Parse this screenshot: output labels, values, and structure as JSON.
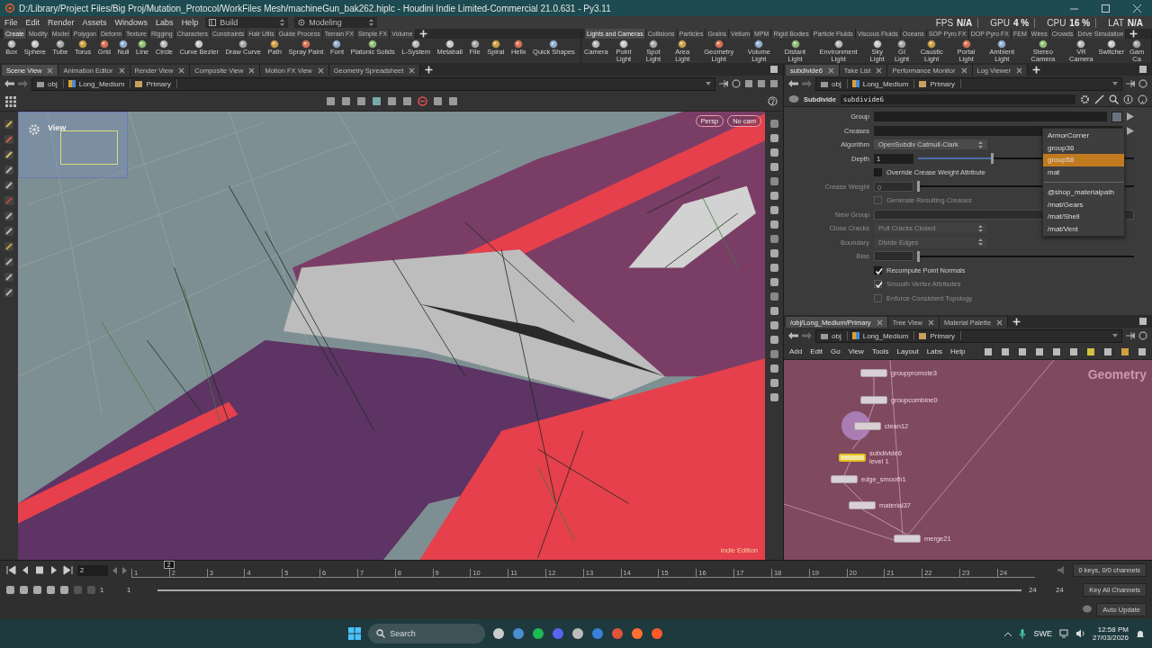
{
  "window": {
    "title": "D:/Library/Project Files/Big Proj/Mutation_Protocol/WorkFiles Mesh/machineGun_bak262.hiplc - Houdini Indie Limited-Commercial 21.0.631 - Py3.11"
  },
  "menu": [
    "File",
    "Edit",
    "Render",
    "Assets",
    "Windows",
    "Labs",
    "Help"
  ],
  "desktops": [
    {
      "label": "Build"
    },
    {
      "label": "Modeling"
    }
  ],
  "performance": [
    {
      "label": "FPS",
      "value": "N/A"
    },
    {
      "label": "GPU",
      "value": "4 %"
    },
    {
      "label": "CPU",
      "value": "16 %"
    },
    {
      "label": "LAT",
      "value": "N/A"
    }
  ],
  "shelves": [
    {
      "tabs": [
        {
          "label": "Create",
          "selected": true
        },
        {
          "label": "Modify",
          "selected": false
        },
        {
          "label": "Model",
          "selected": false
        },
        {
          "label": "Polygon",
          "selected": false
        },
        {
          "label": "Deform",
          "selected": false
        },
        {
          "label": "Texture",
          "selected": false
        },
        {
          "label": "Rigging",
          "selected": false
        },
        {
          "label": "Characters",
          "selected": false
        },
        {
          "label": "Constraints",
          "selected": false
        },
        {
          "label": "Hair Utils",
          "selected": false
        },
        {
          "label": "Guide Process",
          "selected": false
        },
        {
          "label": "Terrain FX",
          "selected": false
        },
        {
          "label": "Simple FX",
          "selected": false
        },
        {
          "label": "Volume",
          "selected": false
        }
      ],
      "tools": [
        "Box",
        "Sphere",
        "Tube",
        "Torus",
        "Grid",
        "Null",
        "Line",
        "Circle",
        "Curve Bezier",
        "Draw Curve",
        "Path",
        "Spray Paint",
        "Font",
        "Platonic Solids",
        "L-System",
        "Metaball",
        "File",
        "Spiral",
        "Helix",
        "Quick Shapes"
      ]
    },
    {
      "tabs": [
        {
          "label": "Lights and Cameras",
          "selected": true
        },
        {
          "label": "Collisions",
          "selected": false
        },
        {
          "label": "Particles",
          "selected": false
        },
        {
          "label": "Grains",
          "selected": false
        },
        {
          "label": "Vellum",
          "selected": false
        },
        {
          "label": "MPM",
          "selected": false
        },
        {
          "label": "Rigid Bodies",
          "selected": false
        },
        {
          "label": "Particle Fluids",
          "selected": false
        },
        {
          "label": "Viscous Fluids",
          "selected": false
        },
        {
          "label": "Oceans",
          "selected": false
        },
        {
          "label": "SOP Pyro FX",
          "selected": false
        },
        {
          "label": "DOP Pyro FX",
          "selected": false
        },
        {
          "label": "FEM",
          "selected": false
        },
        {
          "label": "Wires",
          "selected": false
        },
        {
          "label": "Crowds",
          "selected": false
        },
        {
          "label": "Drive Simulation",
          "selected": false
        }
      ],
      "tools": [
        "Camera",
        "Point Light",
        "Spot Light",
        "Area Light",
        "Geometry Light",
        "Volume Light",
        "Distant Light",
        "Environment Light",
        "Sky Light",
        "GI Light",
        "Caustic Light",
        "Portal Light",
        "Ambient Light",
        "Stereo Camera",
        "VR Camera",
        "Switcher",
        "Gam Ca"
      ]
    }
  ],
  "scene_pane": {
    "tabs": [
      {
        "label": "Scene View",
        "selected": true
      },
      {
        "label": "Animation Editor",
        "selected": false
      },
      {
        "label": "Render View",
        "selected": false
      },
      {
        "label": "Composite View",
        "selected": false
      },
      {
        "label": "Motion FX View",
        "selected": false
      },
      {
        "label": "Geometry Spreadsheet",
        "selected": false
      }
    ],
    "path": [
      "obj",
      "Long_Medium",
      "Primary"
    ],
    "viewport": {
      "label": "View",
      "camera_menus": [
        "Persp",
        "No cam"
      ],
      "edition": "Indie Edition"
    }
  },
  "parameter_pane": {
    "tabs": [
      {
        "label": "subdivide6",
        "selected": true
      },
      {
        "label": "Take List",
        "selected": false
      },
      {
        "label": "Performance Monitor",
        "selected": false
      },
      {
        "label": "Log Viewer",
        "selected": false
      }
    ],
    "path": [
      "obj",
      "Long_Medium",
      "Primary"
    ],
    "node_type": "Subdivide",
    "node_name": "subdivide6",
    "parameters": [
      {
        "kind": "field",
        "label": "Group",
        "disabled": false
      },
      {
        "kind": "field",
        "label": "Creases",
        "disabled": false
      },
      {
        "kind": "menu",
        "label": "Algorithm",
        "value": "OpenSubdiv Catmull-Clark",
        "disabled": false
      },
      {
        "kind": "slider",
        "label": "Depth",
        "value": "1",
        "level": 0.34,
        "disabled": false
      },
      {
        "kind": "checkbox",
        "label": "Override Crease Weight Attribute",
        "checked": false,
        "disabled": false
      },
      {
        "kind": "slider",
        "label": "Crease Weight",
        "value": "0",
        "level": 0,
        "disabled": true
      },
      {
        "kind": "checkbox",
        "label": "Generate Resulting Creases",
        "checked": false,
        "disabled": true
      },
      {
        "kind": "field",
        "label": "New Group",
        "disabled": true
      },
      {
        "kind": "menu",
        "label": "Close Cracks",
        "value": "Pull Cracks Closed",
        "disabled": true
      },
      {
        "kind": "menu",
        "label": "Boundary",
        "value": "Divide Edges",
        "disabled": true
      },
      {
        "kind": "slider",
        "label": "Bias",
        "level": 0,
        "disabled": true
      },
      {
        "kind": "checkbox",
        "label": "Recompute Point Normals",
        "checked": true,
        "disabled": false
      },
      {
        "kind": "checkbox",
        "label": "Smooth Vertex Attributes",
        "checked": true,
        "disabled": true
      },
      {
        "kind": "checkbox",
        "label": "Enforce Consistent Topology",
        "checked": false,
        "disabled": true
      }
    ],
    "menu_popup": [
      [
        {
          "label": "ArmorCorner",
          "selected": false
        },
        {
          "label": "group36",
          "selected": false
        },
        {
          "label": "group58",
          "selected": true
        },
        {
          "label": "mat",
          "selected": false
        }
      ],
      [
        {
          "label": "@shop_materialpath",
          "selected": false
        },
        {
          "label": "/mat/Gears",
          "selected": false
        },
        {
          "label": "/mat/Shell",
          "selected": false
        },
        {
          "label": "/mat/Vent",
          "selected": false
        }
      ]
    ]
  },
  "network_pane": {
    "tabs": [
      {
        "label": "/obj/Long_Medium/Primary",
        "selected": true
      },
      {
        "label": "Tree View",
        "selected": false
      },
      {
        "label": "Material Palette",
        "selected": false
      }
    ],
    "path": [
      "obj",
      "Long_Medium",
      "Primary"
    ],
    "menu": [
      "Add",
      "Edit",
      "Go",
      "View",
      "Tools",
      "Layout",
      "Labs",
      "Help"
    ],
    "context": "Geometry",
    "nodes": [
      {
        "name": "grouppromote3",
        "selected": false
      },
      {
        "name": "groupcombine0",
        "selected": false
      },
      {
        "name": "clean12",
        "selected": false
      },
      {
        "name": "subdivide6",
        "comment": "level 1",
        "selected": true
      },
      {
        "name": "edge_smooth1",
        "selected": false
      },
      {
        "name": "material37",
        "selected": false
      },
      {
        "name": "merge21",
        "selected": false
      }
    ]
  },
  "timeline": {
    "frame": "2",
    "current_marker": "2",
    "ticks": [
      "1",
      "2",
      "3",
      "4",
      "5",
      "6",
      "7",
      "8",
      "9",
      "10",
      "11",
      "12",
      "13",
      "14",
      "15",
      "16",
      "17",
      "18",
      "19",
      "20",
      "21",
      "22",
      "23",
      "24"
    ],
    "range_start": [
      "1",
      "1"
    ],
    "range_end": [
      "24",
      "24"
    ],
    "keys_info": "0 keys, 0/0 channels",
    "key_button": "Key All Channels",
    "update_mode": "Auto Update"
  },
  "taskbar": {
    "search": {
      "placeholder": "Search"
    },
    "language": "SWE",
    "time": "12:58 PM",
    "date": "27/03/2026"
  }
}
